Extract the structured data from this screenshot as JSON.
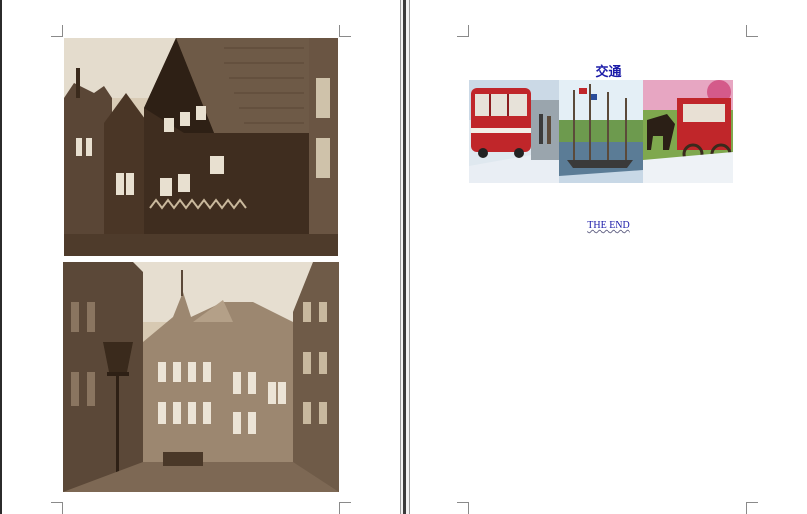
{
  "document": {
    "left_page": {
      "photos": [
        {
          "name": "half-timbered-houses-photo",
          "tone": "sepia"
        },
        {
          "name": "old-street-with-lamp-photo",
          "tone": "sepia"
        }
      ]
    },
    "right_page": {
      "heading": "交通",
      "banner": {
        "panels": [
          "red-bus-panel",
          "harbor-sailboats-panel",
          "horse-carriage-panel"
        ]
      },
      "closing_text": "THE  END"
    }
  },
  "colors": {
    "heading": "#1a1aa8",
    "sepia_light": "#d8c8b0",
    "sepia_dark": "#3a2a1c",
    "bus_red": "#c0262a"
  }
}
